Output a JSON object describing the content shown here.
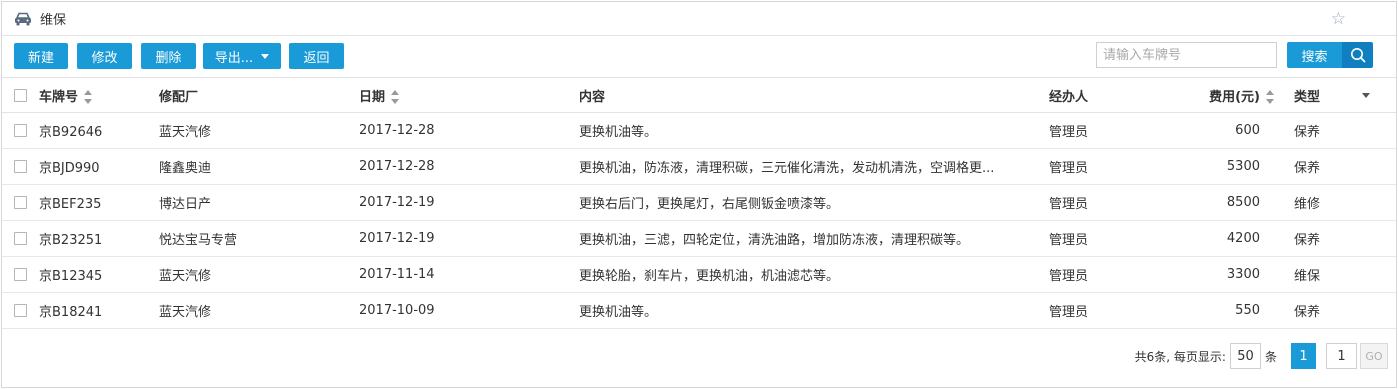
{
  "title": "维保",
  "toolbar": {
    "buttons": [
      "新建",
      "修改",
      "删除",
      "导出...",
      "返回"
    ],
    "search_placeholder": "请输入车牌号",
    "search_label": "搜索"
  },
  "table": {
    "headers": {
      "plate": "车牌号",
      "shop": "修配厂",
      "date": "日期",
      "content": "内容",
      "handler": "经办人",
      "cost": "费用(元)",
      "type": "类型"
    },
    "rows": [
      {
        "plate": "京B92646",
        "shop": "蓝天汽修",
        "date": "2017-12-28",
        "content": "更换机油等。",
        "handler": "管理员",
        "cost": "600",
        "type": "保养"
      },
      {
        "plate": "京BJD990",
        "shop": "隆鑫奥迪",
        "date": "2017-12-28",
        "content": "更换机油，防冻液，清理积碳，三元催化清洗，发动机清洗，空调格更...",
        "handler": "管理员",
        "cost": "5300",
        "type": "保养"
      },
      {
        "plate": "京BEF235",
        "shop": "博达日产",
        "date": "2017-12-19",
        "content": "更换右后门，更换尾灯，右尾侧钣金喷漆等。",
        "handler": "管理员",
        "cost": "8500",
        "type": "维修"
      },
      {
        "plate": "京B23251",
        "shop": "悦达宝马专营",
        "date": "2017-12-19",
        "content": "更换机油，三滤，四轮定位，清洗油路，增加防冻液，清理积碳等。",
        "handler": "管理员",
        "cost": "4200",
        "type": "保养"
      },
      {
        "plate": "京B12345",
        "shop": "蓝天汽修",
        "date": "2017-11-14",
        "content": "更换轮胎，刹车片，更换机油，机油滤芯等。",
        "handler": "管理员",
        "cost": "3300",
        "type": "维保"
      },
      {
        "plate": "京B18241",
        "shop": "蓝天汽修",
        "date": "2017-10-09",
        "content": "更换机油等。",
        "handler": "管理员",
        "cost": "550",
        "type": "保养"
      }
    ]
  },
  "pagination": {
    "summary": "共6条, 每页显示:",
    "page_size": "50",
    "unit": "条",
    "current_page": "1",
    "jump_value": "1",
    "go_label": "GO"
  },
  "colors": {
    "accent": "#1a9ad6",
    "accent_dark": "#0f7fbf"
  }
}
